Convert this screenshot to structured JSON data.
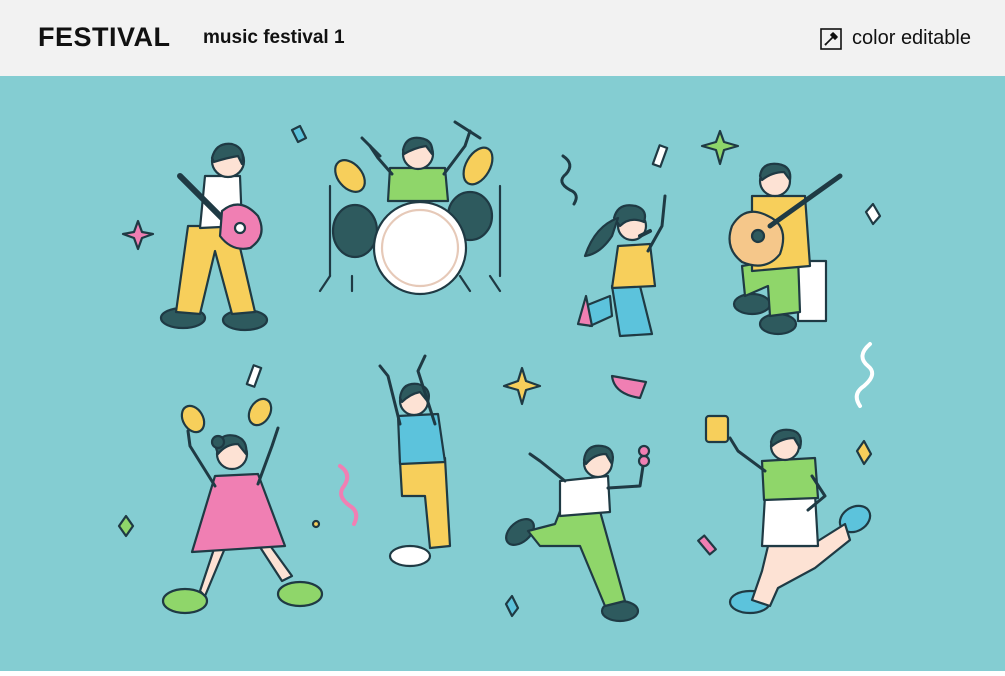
{
  "header": {
    "brand": "FESTIVAL",
    "title": "music festival 1",
    "badge_label": "color editable",
    "badge_icon": "eyedropper-icon"
  },
  "colors": {
    "background": "#84cdd2",
    "header_bg": "#f2f2f2",
    "outline": "#1f3a44",
    "skin": "#fde2d4",
    "yellow": "#f7cf5b",
    "pink": "#f07fb3",
    "green": "#8fd66a",
    "blue": "#5cc3dc",
    "dark": "#2e5a5e"
  }
}
